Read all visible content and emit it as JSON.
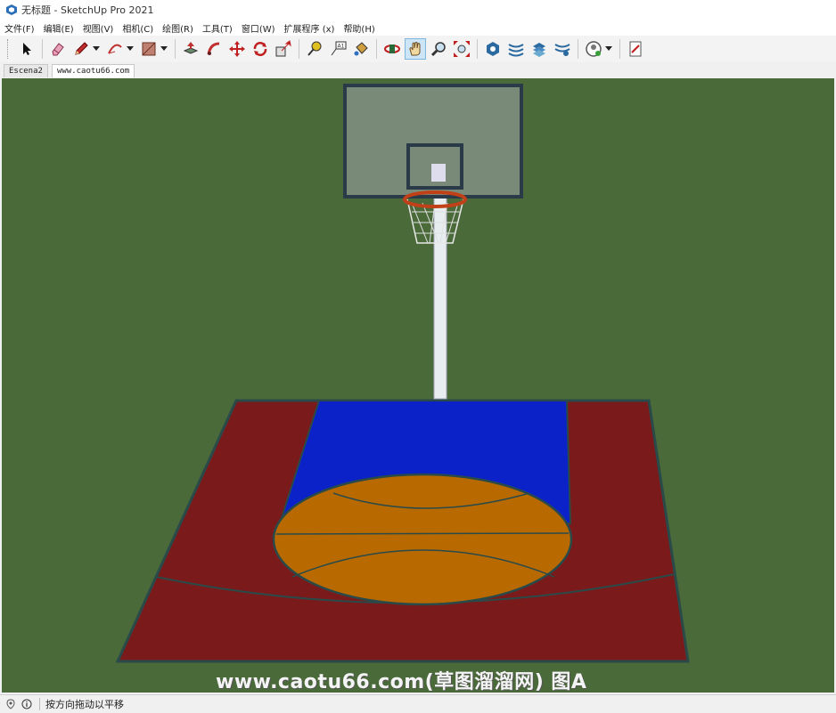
{
  "window": {
    "title": "无标题 - SketchUp Pro 2021"
  },
  "menu": [
    "文件(F)",
    "编辑(E)",
    "视图(V)",
    "相机(C)",
    "绘图(R)",
    "工具(T)",
    "窗口(W)",
    "扩展程序 (x)",
    "帮助(H)"
  ],
  "toolbar": {
    "groups": [
      [
        "select-icon"
      ],
      [
        "eraser-icon",
        "pencil-icon",
        "arc-icon",
        "rectangle-icon"
      ],
      [
        "push-pull-icon",
        "follow-me-icon",
        "move-icon",
        "rotate-icon",
        "scale-icon"
      ],
      [
        "tape-measure-icon",
        "text-icon",
        "paint-bucket-icon"
      ],
      [
        "orbit-icon",
        "pan-icon",
        "zoom-icon",
        "zoom-extents-icon"
      ],
      [
        "warehouse-icon",
        "extension-warehouse-icon",
        "layout-icon",
        "extension-manager-icon"
      ],
      [
        "account-icon"
      ],
      [
        "send-to-layout-icon"
      ]
    ],
    "active_tool": "pan-icon"
  },
  "tabs": [
    {
      "label": "Escena2",
      "active": false
    },
    {
      "label": "www.caotu66.com",
      "active": true
    }
  ],
  "scene": {
    "description_colors": {
      "ground": "#4a6a3a",
      "court_outer": "#7a1a1a",
      "paint": "#0a22c8",
      "circle": "#b86a00",
      "lines": "#2a4a4a"
    }
  },
  "watermark": "www.caotu66.com(草图溜溜网) 图A",
  "status": {
    "text": "按方向拖动以平移"
  }
}
